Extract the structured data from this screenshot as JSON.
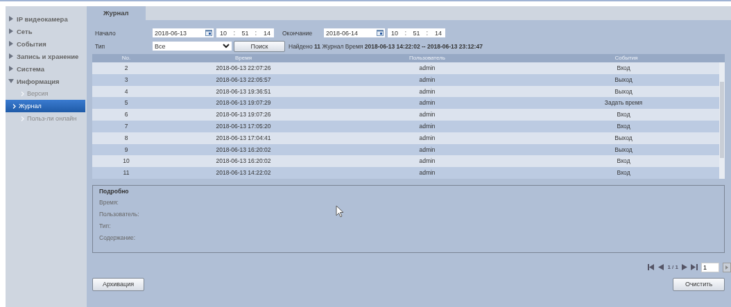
{
  "sidebar": {
    "items": [
      {
        "label": "IP видеокамера",
        "expanded": false
      },
      {
        "label": "Сеть",
        "expanded": false
      },
      {
        "label": "События",
        "expanded": false
      },
      {
        "label": "Запись и хранение",
        "expanded": false
      },
      {
        "label": "Система",
        "expanded": false
      },
      {
        "label": "Информация",
        "expanded": true,
        "children": [
          {
            "label": "Версия",
            "selected": false
          },
          {
            "label": "Журнал",
            "selected": true
          },
          {
            "label": "Польз-ли онлайн",
            "selected": false
          }
        ]
      }
    ]
  },
  "tabs": [
    {
      "label": "Журнал",
      "selected": true
    }
  ],
  "filters": {
    "start_label": "Начало",
    "start_date": "2018-06-13",
    "start_time": [
      "10",
      "51",
      "14"
    ],
    "end_label": "Окончание",
    "end_date": "2018-06-14",
    "end_time": [
      "10",
      "51",
      "14"
    ],
    "type_label": "Тип",
    "type_value": "Все",
    "search_button": "Поиск",
    "result": "Найдено **11** Журнал Время **2018-06-13 14:22:02 -- 2018-06-13 23:12:47**"
  },
  "table": {
    "columns": [
      "No.",
      "Время",
      "Пользователь",
      "События"
    ],
    "rows": [
      [
        "2",
        "2018-06-13 22:07:26",
        "admin",
        "Вход"
      ],
      [
        "3",
        "2018-06-13 22:05:57",
        "admin",
        "Выход"
      ],
      [
        "4",
        "2018-06-13 19:36:51",
        "admin",
        "Выход"
      ],
      [
        "5",
        "2018-06-13 19:07:29",
        "admin",
        "Задать время"
      ],
      [
        "6",
        "2018-06-13 19:07:26",
        "admin",
        "Вход"
      ],
      [
        "7",
        "2018-06-13 17:05:20",
        "admin",
        "Вход"
      ],
      [
        "8",
        "2018-06-13 17:04:41",
        "admin",
        "Выход"
      ],
      [
        "9",
        "2018-06-13 16:20:02",
        "admin",
        "Выход"
      ],
      [
        "10",
        "2018-06-13 16:20:02",
        "admin",
        "Вход"
      ],
      [
        "11",
        "2018-06-13 14:22:02",
        "admin",
        "Вход"
      ]
    ]
  },
  "details": {
    "title": "Подробно",
    "fields": [
      "Время:",
      "Пользователь:",
      "Тип:",
      "Содержание:"
    ]
  },
  "pager": {
    "page": "1 / 1",
    "input": "1"
  },
  "buttons": {
    "backup": "Архивация",
    "clear": "Очистить"
  }
}
